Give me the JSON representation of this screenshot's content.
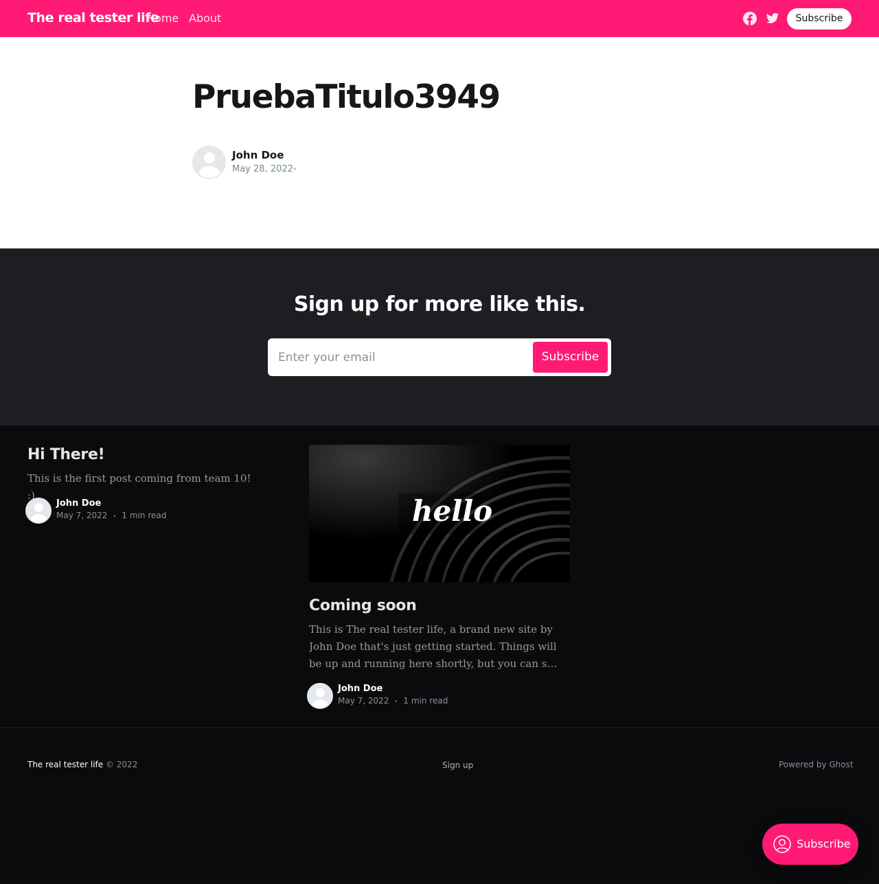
{
  "header": {
    "brand": "The real tester life",
    "nav": [
      {
        "label": "Home"
      },
      {
        "label": "About"
      }
    ],
    "social": [
      "facebook-icon",
      "twitter-icon"
    ],
    "subscribe_label": "Subscribe",
    "background_color": "#ff1a75"
  },
  "article": {
    "title": "PruebaTitulo3949",
    "author": "John Doe",
    "date": "May 28, 2022",
    "separator": "•"
  },
  "signup": {
    "heading": "Sign up for more like this.",
    "email_placeholder": "Enter your email",
    "button_label": "Subscribe"
  },
  "posts": [
    {
      "title": "Hi There!",
      "excerpt": "This is the first post coming from team 10! :)",
      "author": "John Doe",
      "date": "May 7, 2022",
      "read_time": "1 min read"
    },
    {
      "title": "Coming soon",
      "image_text": "hello",
      "excerpt": "This is The real tester life, a brand new site by John Doe that's just getting started. Things will be up and running here shortly, but you can subscribe in the meantime if you'd like to stay up to date and receive emails when new content is published!",
      "author": "John Doe",
      "date": "May 7, 2022",
      "read_time": "1 min read"
    }
  ],
  "footer": {
    "site_name": "The real tester life",
    "copyright": "© 2022",
    "signup_link": "Sign up",
    "powered_by": "Powered by Ghost"
  },
  "portal": {
    "label": "Subscribe"
  },
  "colors": {
    "accent": "#ff1a75",
    "signup_bg": "#1c1e22",
    "feed_bg": "#0a0b0c"
  }
}
